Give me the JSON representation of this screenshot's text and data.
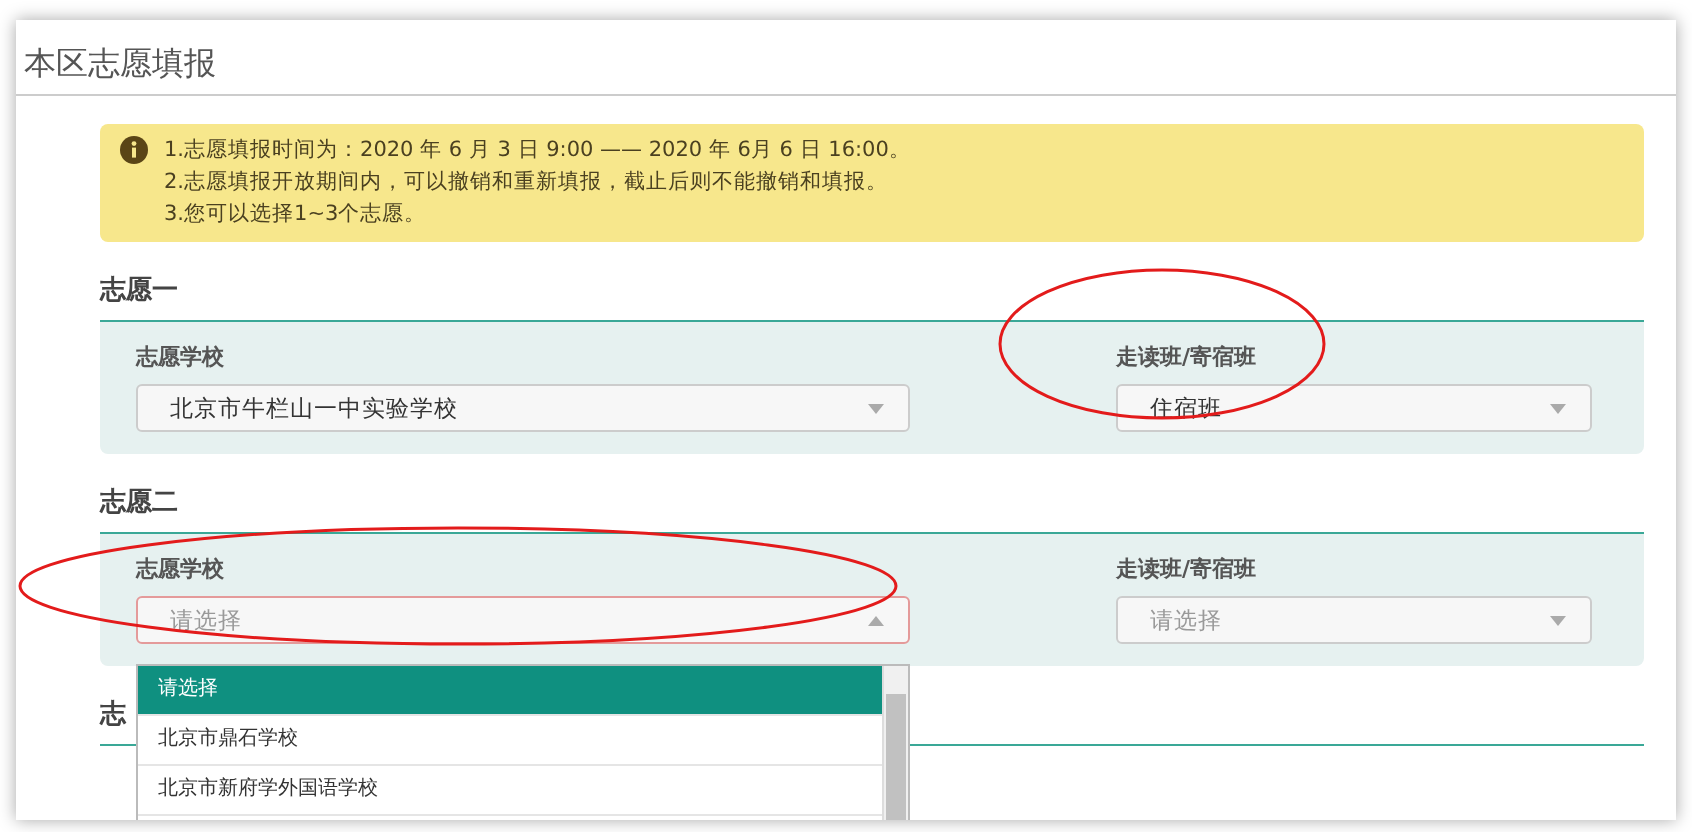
{
  "page_title": "本区志愿填报",
  "notice": {
    "lines": [
      "1.志愿填报时间为：2020 年 6 月 3 日 9:00 —— 2020 年 6月 6 日 16:00。",
      "2.志愿填报开放期间内，可以撤销和重新填报，截止后则不能撤销和填报。",
      "3.您可以选择1~3个志愿。"
    ]
  },
  "choices": [
    {
      "heading": "志愿一",
      "fields": [
        {
          "label": "志愿学校",
          "value": "北京市牛栏山一中实验学校",
          "open": false
        },
        {
          "label": "走读班/寄宿班",
          "value": "住宿班",
          "open": false
        }
      ]
    },
    {
      "heading": "志愿二",
      "fields": [
        {
          "label": "志愿学校",
          "placeholder": "请选择",
          "open": true,
          "options": [
            {
              "label": "请选择",
              "selected": true
            },
            {
              "label": "北京市鼎石学校",
              "selected": false
            },
            {
              "label": "北京市新府学外国语学校",
              "selected": false
            }
          ]
        },
        {
          "label": "走读班/寄宿班",
          "placeholder": "请选择",
          "open": false
        }
      ]
    },
    {
      "heading": "志"
    }
  ]
}
